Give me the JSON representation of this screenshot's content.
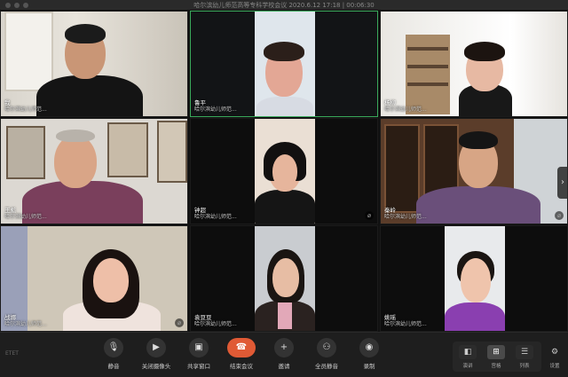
{
  "window": {
    "title": "哈尔滨幼儿师范高等专科学校会议 2020.6.12 17:18 | 00:06:30"
  },
  "participants": [
    {
      "name": "我",
      "org": "哈尔滨幼儿师范...",
      "muted": false,
      "speaking": false
    },
    {
      "name": "鲁平",
      "org": "哈尔滨幼儿师范...",
      "muted": false,
      "speaking": true
    },
    {
      "name": "杨柳",
      "org": "哈尔滨幼儿师范...",
      "muted": false,
      "speaking": false
    },
    {
      "name": "王彪",
      "org": "哈尔滨幼儿师范...",
      "muted": false,
      "speaking": false
    },
    {
      "name": "钟超",
      "org": "哈尔滨幼儿师范...",
      "muted": true,
      "speaking": false
    },
    {
      "name": "秦岭",
      "org": "哈尔滨幼儿师范...",
      "muted": true,
      "speaking": false
    },
    {
      "name": "战娜",
      "org": "哈尔滨幼儿师范...",
      "muted": true,
      "speaking": false
    },
    {
      "name": "袁豆豆",
      "org": "哈尔滨幼儿师范...",
      "muted": false,
      "speaking": false
    },
    {
      "name": "姚瑶",
      "org": "哈尔滨幼儿师范...",
      "muted": false,
      "speaking": false
    }
  ],
  "toolbar": {
    "logo": "ETET",
    "mute": "静音",
    "camera_off": "关闭摄像头",
    "share": "共享窗口",
    "end": "结束会议",
    "invite": "邀请",
    "mute_all": "全员静音",
    "record": "录制",
    "view_speaker": "演讲",
    "view_gallery": "宫格",
    "view_list": "列表",
    "settings": "设置"
  },
  "colors": {
    "speaking_border": "#39a85a",
    "end_button": "#e05a35"
  },
  "icons": [
    "mic-icon",
    "camera-icon",
    "share-icon",
    "hangup-icon",
    "invite-icon",
    "mute-all-icon",
    "record-icon",
    "speaker-view-icon",
    "gallery-view-icon",
    "list-view-icon",
    "gear-icon",
    "mic-off-icon",
    "chevron-right-icon"
  ]
}
